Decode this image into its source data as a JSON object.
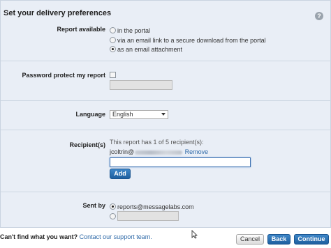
{
  "panel": {
    "title": "Set your delivery preferences",
    "help_icon": "question-icon",
    "help_glyph": "?"
  },
  "report_available": {
    "label": "Report available",
    "options": [
      {
        "label": "in the portal",
        "checked": false
      },
      {
        "label": "via an email link to a secure download from the portal",
        "checked": false
      },
      {
        "label": "as an email attachment",
        "checked": true
      }
    ]
  },
  "password": {
    "label": "Password protect my report",
    "checked": false,
    "value": ""
  },
  "language": {
    "label": "Language",
    "selected": "English"
  },
  "recipients": {
    "label": "Recipient(s)",
    "summary": "This report has 1 of 5 recipient(s):",
    "entry_prefix": "jcoltrin@",
    "remove_label": "Remove",
    "input_value": "",
    "add_label": "Add"
  },
  "sent_by": {
    "label": "Sent by",
    "options": [
      {
        "label": "reports@messagelabs.com",
        "checked": true
      },
      {
        "label": "",
        "checked": false
      }
    ]
  },
  "footer": {
    "question": "Can't find what you want?",
    "link": "Contact our support team.",
    "cancel_label": "Cancel",
    "back_label": "Back",
    "continue_label": "Continue"
  },
  "colors": {
    "panel_bg": "#e9eef6",
    "accent_blue": "#1e5f9f",
    "link": "#2f6aa8"
  }
}
